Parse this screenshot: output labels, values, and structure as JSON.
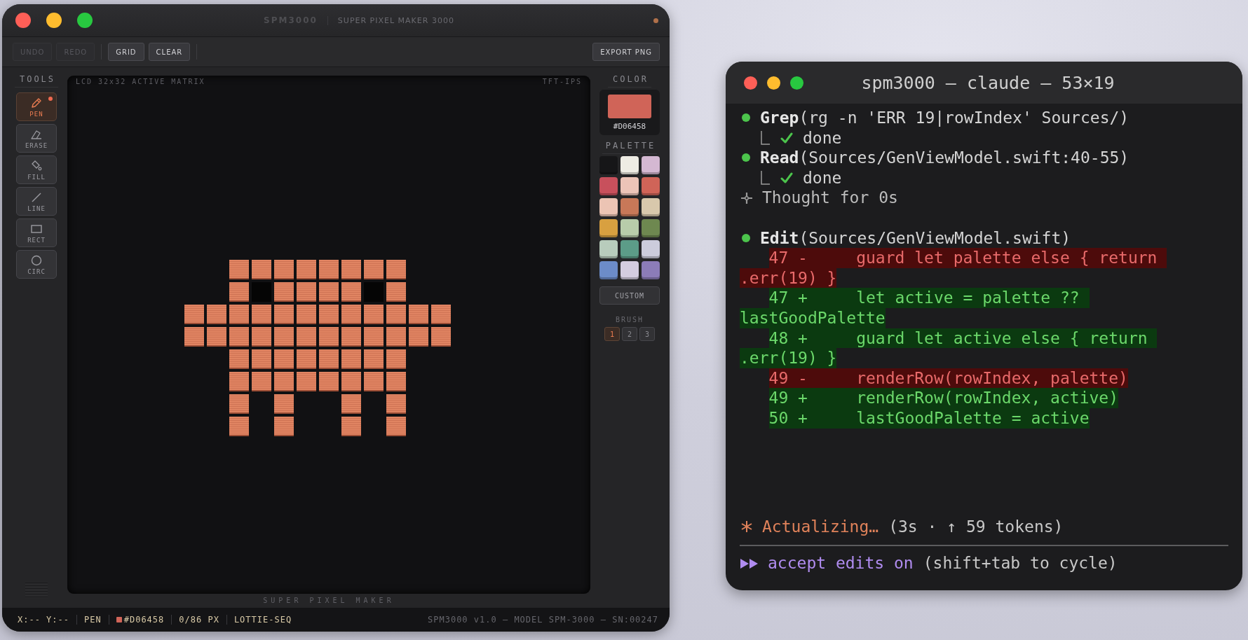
{
  "app_window": {
    "title": "SPM3000",
    "subtitle": "SUPER PIXEL MAKER 3000",
    "toolbar": [
      {
        "label": "UNDO",
        "disabled": true
      },
      {
        "label": "REDO",
        "disabled": true
      },
      {
        "label": "GRID",
        "disabled": false
      },
      {
        "label": "CLEAR",
        "disabled": false
      }
    ],
    "export_button": "EXPORT PNG",
    "tools": {
      "heading": "TOOLS",
      "items": [
        {
          "label": "PEN",
          "kind": "pen",
          "selected": true
        },
        {
          "label": "ERASE",
          "kind": "erase",
          "selected": false
        },
        {
          "label": "FILL",
          "kind": "fill",
          "selected": false
        },
        {
          "label": "LINE",
          "kind": "line",
          "selected": false
        },
        {
          "label": "RECT",
          "kind": "rect",
          "selected": false
        },
        {
          "label": "CIRC",
          "kind": "circ",
          "selected": false
        }
      ]
    },
    "canvas": {
      "label_left": "LCD 32x32 ACTIVE MATRIX",
      "label_right": "TFT-IPS",
      "footer": "SUPER PIXEL MAKER"
    },
    "color_panel": {
      "heading": "COLOR",
      "current": {
        "color": "#d06458",
        "hex": "#D06458"
      },
      "palette_heading": "PALETTE",
      "palette": [
        {
          "color": "#161618"
        },
        {
          "color": "#eeece4"
        },
        {
          "color": "#d4b8d2"
        },
        {
          "color": "#c8505c"
        },
        {
          "color": "#ecc4b8"
        },
        {
          "color": "#d06458"
        },
        {
          "color": "#ecc4b4"
        },
        {
          "color": "#c87858"
        },
        {
          "color": "#d8c8ac"
        },
        {
          "color": "#d8a040"
        },
        {
          "color": "#b8ccaa"
        },
        {
          "color": "#6e8850"
        },
        {
          "color": "#b8ccbc"
        },
        {
          "color": "#5c9c88"
        },
        {
          "color": "#ccccdc"
        },
        {
          "color": "#6c8cc8"
        },
        {
          "color": "#d4cce0"
        },
        {
          "color": "#8c7cb8"
        }
      ],
      "custom_button": "CUSTOM",
      "brush_heading": "BRUSH",
      "brush_sizes": [
        {
          "label": "1",
          "selected": true
        },
        {
          "label": "2",
          "selected": false
        },
        {
          "label": "3",
          "selected": false
        }
      ]
    },
    "status_bar": {
      "items": [
        {
          "text": "X:-- Y:--"
        },
        {
          "text": "PEN"
        },
        {
          "text": "#D06458",
          "color": "#d06458"
        },
        {
          "text": "0/86 PX"
        },
        {
          "text": "LOTTIE-SEQ"
        }
      ],
      "info": "SPM3000 v1.0 — MODEL SPM-3000 — SN:00247"
    }
  },
  "terminal": {
    "title": "spm3000 — claude — 53×19",
    "lines": [
      {
        "kind": "tool",
        "text": "**Grep**(rg -n 'ERR 19|rowIndex' Sources/)"
      },
      {
        "kind": "result",
        "text": "done"
      },
      {
        "kind": "tool",
        "text": "**Read**(Sources/GenViewModel.swift:40-55)"
      },
      {
        "kind": "result",
        "text": "done"
      },
      {
        "kind": "thought",
        "text": "Thought for 0s"
      },
      {
        "kind": "blank"
      },
      {
        "kind": "tool",
        "text": "**Edit**(Sources/GenViewModel.swift)"
      },
      {
        "kind": "diff",
        "removed": true,
        "text": "47 -     guard let palette else { return ",
        "continuation": ".err(19) }"
      },
      {
        "kind": "diff",
        "removed": false,
        "text": "47 +     let active = palette ?? ",
        "continuation": "lastGoodPalette"
      },
      {
        "kind": "diff",
        "removed": false,
        "text": "48 +     guard let active else { return ",
        "continuation": ".err(19) }"
      },
      {
        "kind": "diff",
        "removed": true,
        "text": "49 -     renderRow(rowIndex, palette)"
      },
      {
        "kind": "diff",
        "removed": false,
        "text": "49 +     renderRow(rowIndex, active)"
      },
      {
        "kind": "diff",
        "removed": false,
        "text": "50 +     lastGoodPalette = active"
      }
    ],
    "status": {
      "verb": "Actualizing…",
      "detail": "(3s · ↑ 59 tokens)"
    },
    "mode": {
      "label": "accept edits on",
      "hint": "(shift+tab to cycle)"
    }
  }
}
